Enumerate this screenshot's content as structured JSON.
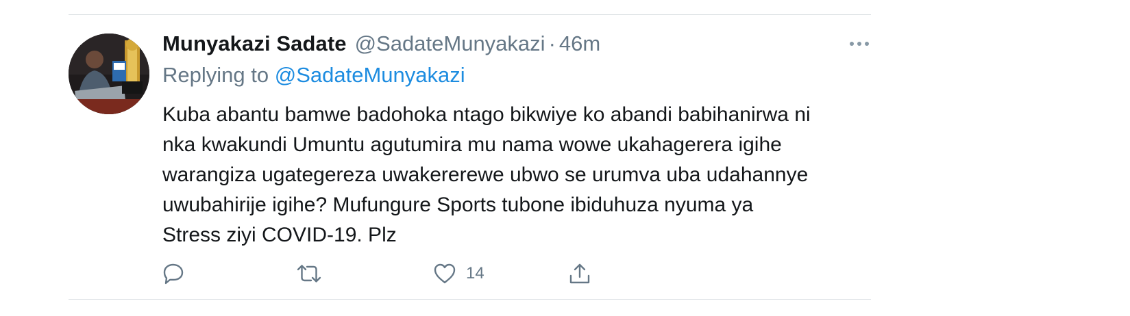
{
  "tweet": {
    "display_name": "Munyakazi Sadate",
    "handle": "@SadateMunyakazi",
    "separator": "·",
    "time": "46m",
    "replying_prefix": "Replying to",
    "replying_to": "@SadateMunyakazi",
    "text_lines": [
      "Kuba abantu bamwe badohoka ntago bikwiye ko abandi babihanirwa ni",
      "nka kwakundi Umuntu agutumira mu nama wowe ukahagerera igihe",
      "warangiza ugategereza uwakererewe ubwo se urumva uba udahannye",
      "uwubahirije igihe? Mufungure Sports tubone ibiduhuza nyuma ya",
      "Stress ziyi COVID-19. Plz"
    ]
  },
  "actions": {
    "reply_icon": "reply-icon",
    "retweet_icon": "retweet-icon",
    "like_icon": "heart-icon",
    "like_count": "14",
    "share_icon": "share-icon",
    "more_icon": "more-dots-icon"
  },
  "colors": {
    "text": "#14171a",
    "secondary": "#657786",
    "link": "#1d8ce0",
    "divider": "#d7dce0"
  }
}
